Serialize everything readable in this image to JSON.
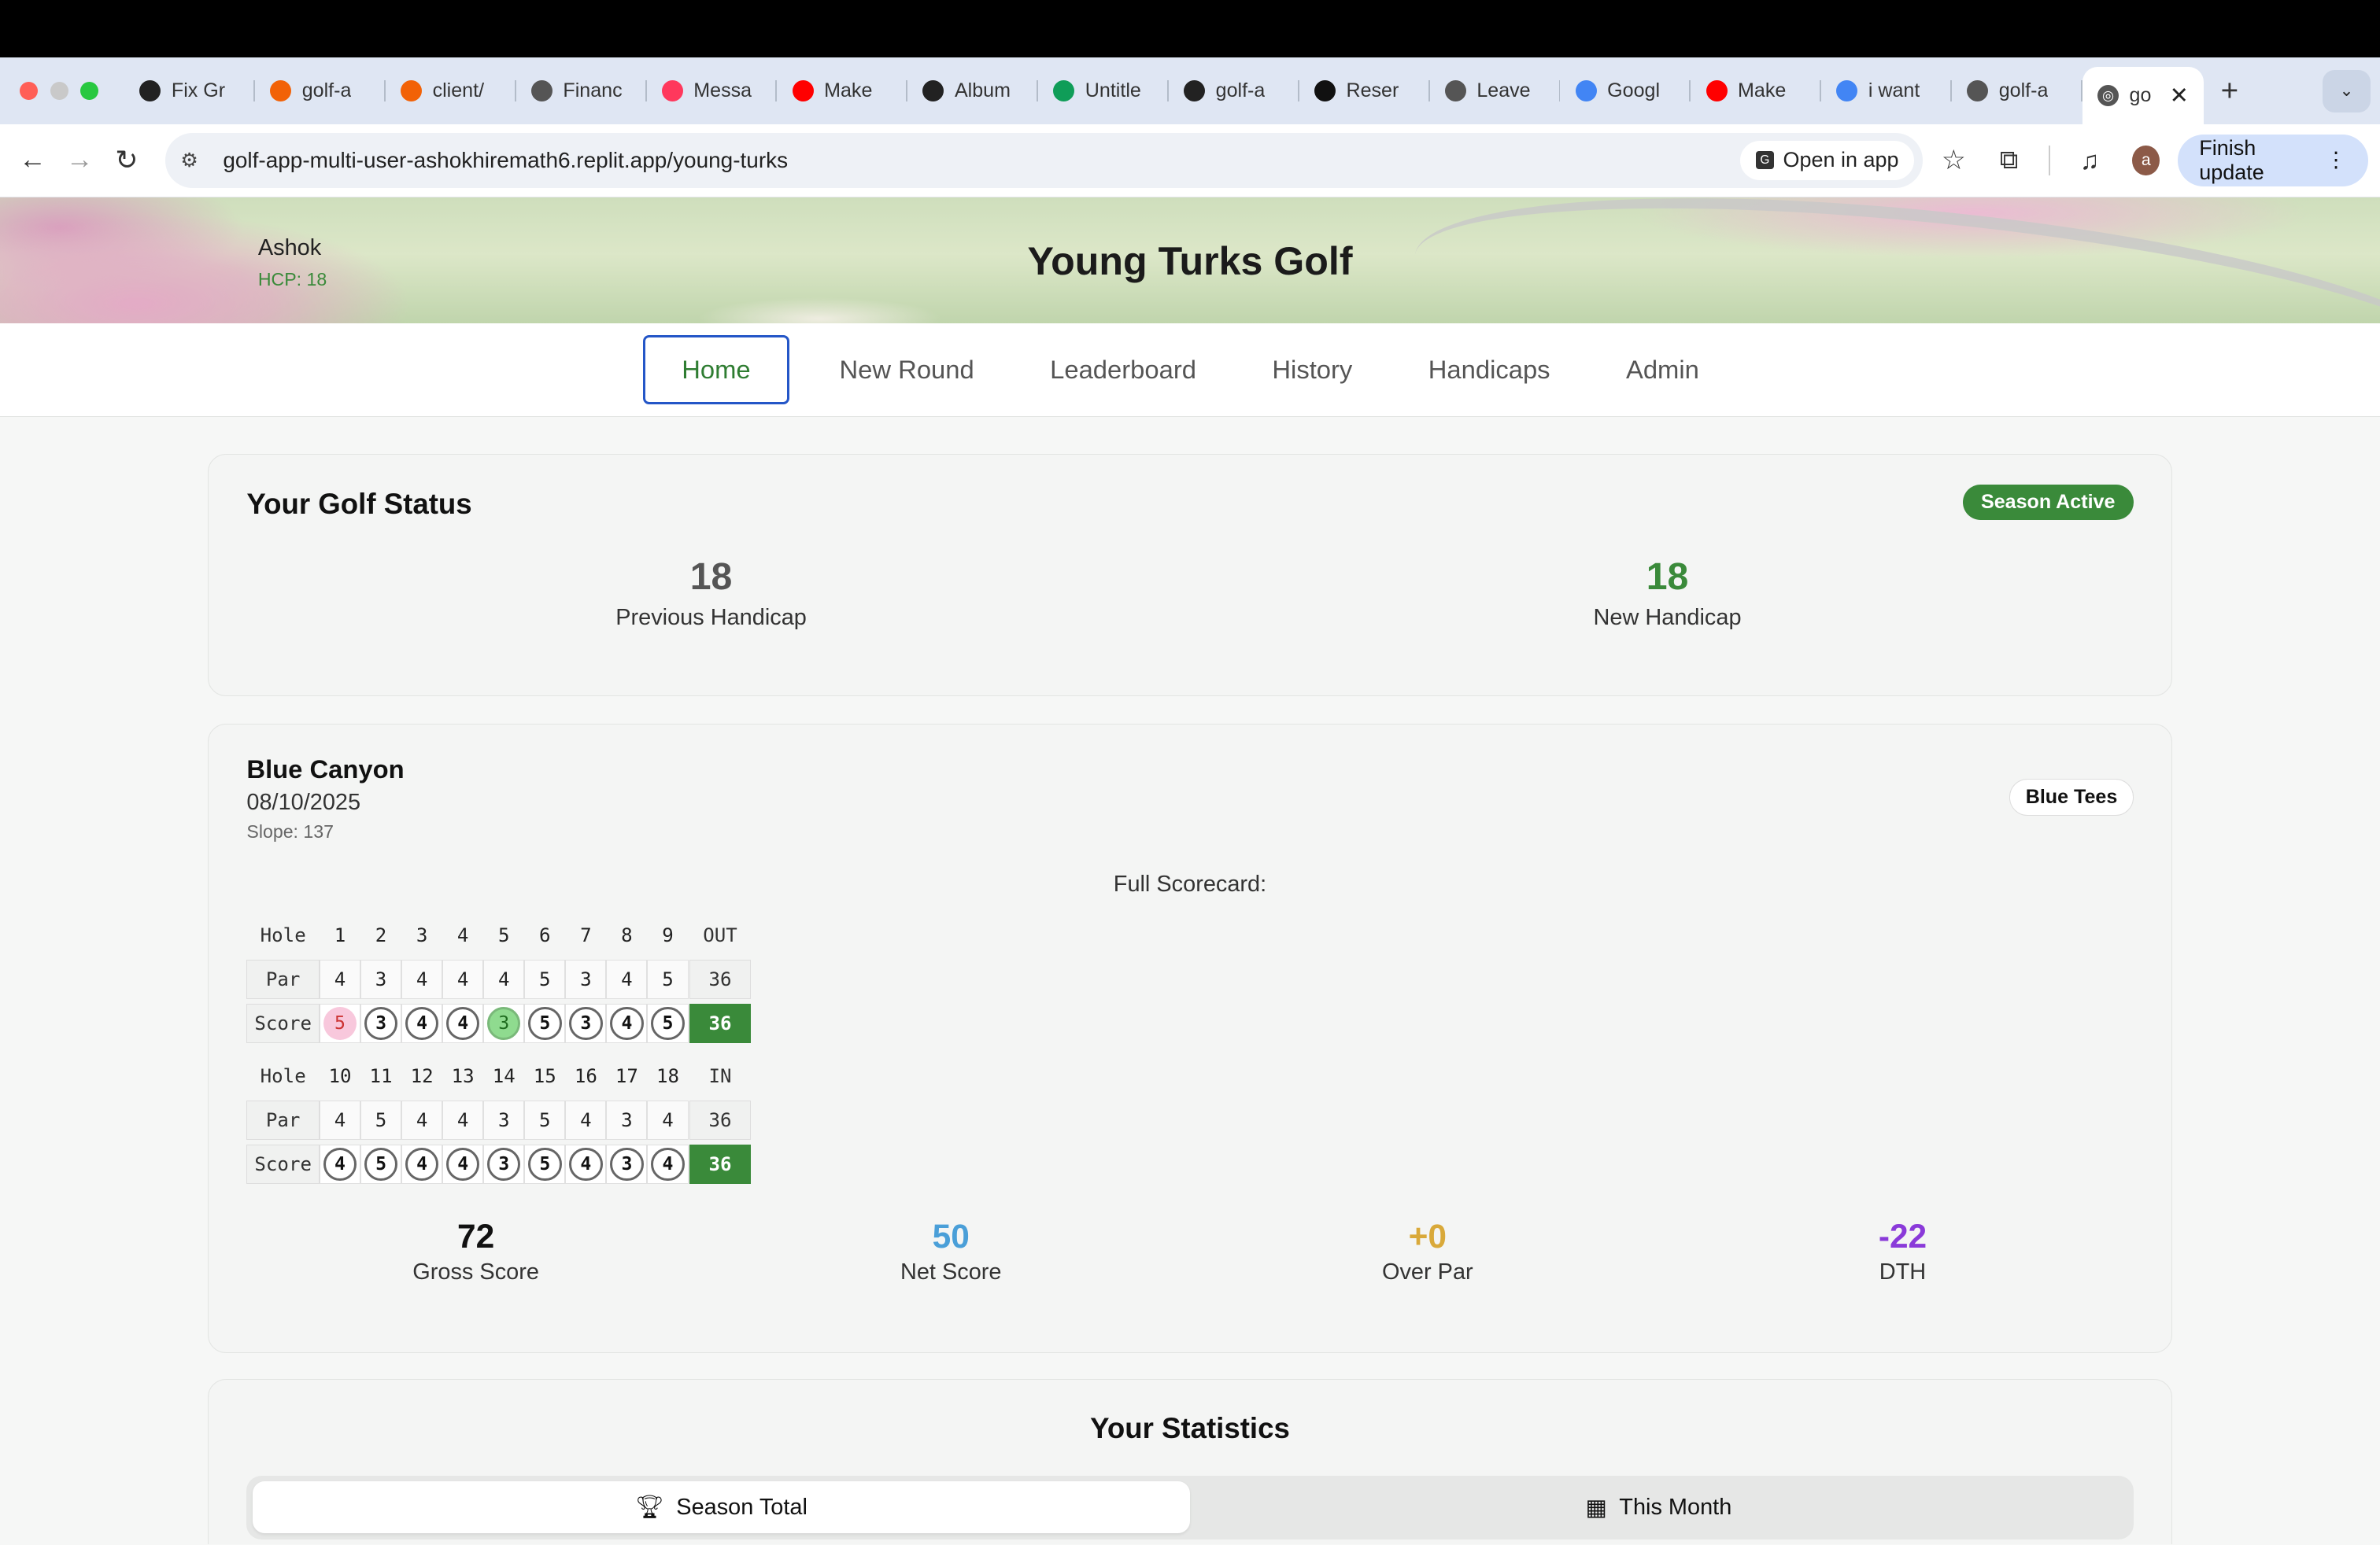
{
  "browser": {
    "tabs": [
      {
        "label": "Fix Gr",
        "icon": "openai-icon",
        "color": "#222"
      },
      {
        "label": "golf-a",
        "icon": "replit-icon",
        "color": "#f26207"
      },
      {
        "label": "client/",
        "icon": "replit-icon",
        "color": "#f26207"
      },
      {
        "label": "Financ",
        "icon": "globe-icon",
        "color": "#555"
      },
      {
        "label": "Messa",
        "icon": "airbnb-icon",
        "color": "#ff385c"
      },
      {
        "label": "Make",
        "icon": "youtube-icon",
        "color": "#ff0000"
      },
      {
        "label": "Album",
        "icon": "openai-icon",
        "color": "#222"
      },
      {
        "label": "Untitle",
        "icon": "sheets-icon",
        "color": "#0f9d58"
      },
      {
        "label": "golf-a",
        "icon": "openai-icon",
        "color": "#222"
      },
      {
        "label": "Reser",
        "icon": "ph-icon",
        "color": "#111"
      },
      {
        "label": "Leave",
        "icon": "globe-icon",
        "color": "#555"
      },
      {
        "label": "Googl",
        "icon": "google-icon",
        "color": "#4285f4"
      },
      {
        "label": "Make",
        "icon": "youtube-icon",
        "color": "#ff0000"
      },
      {
        "label": "i want",
        "icon": "google-icon",
        "color": "#4285f4"
      },
      {
        "label": "golf-a",
        "icon": "globe-icon",
        "color": "#555"
      }
    ],
    "active_tab": {
      "label": "go"
    },
    "url": "golf-app-multi-user-ashokhiremath6.replit.app/young-turks",
    "open_in_app": "Open in app",
    "avatar_letter": "a",
    "finish_update": "Finish update"
  },
  "header": {
    "user_name": "Ashok",
    "hcp": "HCP: 18",
    "title": "Young Turks Golf"
  },
  "nav": {
    "items": [
      "Home",
      "New Round",
      "Leaderboard",
      "History",
      "Handicaps",
      "Admin"
    ]
  },
  "status": {
    "title": "Your Golf Status",
    "badge": "Season Active",
    "previous_handicap": "18",
    "previous_label": "Previous Handicap",
    "new_handicap": "18",
    "new_label": "New Handicap"
  },
  "round": {
    "course": "Blue Canyon",
    "date": "08/10/2025",
    "slope": "Slope: 137",
    "tees": "Blue Tees",
    "scorecard_label": "Full Scorecard:",
    "front": {
      "hole_label": "Hole",
      "par_label": "Par",
      "score_label": "Score",
      "holes": [
        "1",
        "2",
        "3",
        "4",
        "5",
        "6",
        "7",
        "8",
        "9"
      ],
      "total_label": "OUT",
      "par": [
        "4",
        "3",
        "4",
        "4",
        "4",
        "5",
        "3",
        "4",
        "5"
      ],
      "par_total": "36",
      "score": [
        "5",
        "3",
        "4",
        "4",
        "3",
        "5",
        "3",
        "4",
        "5"
      ],
      "score_total": "36"
    },
    "back": {
      "hole_label": "Hole",
      "par_label": "Par",
      "score_label": "Score",
      "holes": [
        "10",
        "11",
        "12",
        "13",
        "14",
        "15",
        "16",
        "17",
        "18"
      ],
      "total_label": "IN",
      "par": [
        "4",
        "5",
        "4",
        "4",
        "3",
        "5",
        "4",
        "3",
        "4"
      ],
      "par_total": "36",
      "score": [
        "4",
        "5",
        "4",
        "4",
        "3",
        "5",
        "4",
        "3",
        "4"
      ],
      "score_total": "36"
    },
    "summary": {
      "gross": "72",
      "gross_label": "Gross Score",
      "net": "50",
      "net_label": "Net Score",
      "over_par": "+0",
      "over_par_label": "Over Par",
      "dth": "-22",
      "dth_label": "DTH"
    }
  },
  "statistics": {
    "title": "Your Statistics",
    "season_total": "Season Total",
    "this_month": "This Month"
  },
  "colors": {
    "accent_green": "#3a8a3a",
    "net_blue": "#4a9fd8",
    "over_par_gold": "#d9a93a",
    "dth_purple": "#8a3ad9"
  }
}
